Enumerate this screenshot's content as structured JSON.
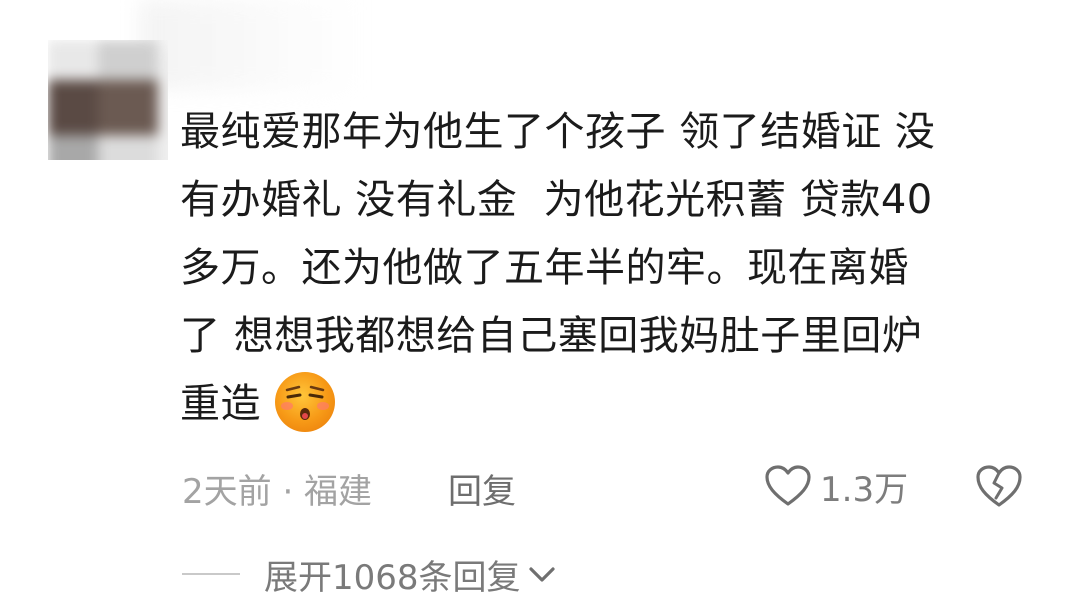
{
  "comment": {
    "lines": [
      "最纯爱那年为他生了个孩子 领了结婚证 没",
      "有办婚礼 没有礼金  为他花光积蓄 贷款40",
      "多万。还为他做了五年半的牢。现在离婚",
      "了 想想我都想给自己塞回我妈肚子里回炉",
      "重造"
    ],
    "emoji": "tired-face-emoji"
  },
  "meta": {
    "time_location": "2天前 · 福建",
    "reply_label": "回复"
  },
  "actions": {
    "like_icon": "heart-outline-icon",
    "like_count": "1.3万",
    "dislike_icon": "broken-heart-outline-icon"
  },
  "expand": {
    "label": "展开1068条回复",
    "icon": "chevron-down-icon"
  },
  "colors": {
    "text": "#1b1b1b",
    "meta": "#a3a3a3",
    "muted": "#7a7a7a",
    "emoji_face": "#f7a21b"
  }
}
